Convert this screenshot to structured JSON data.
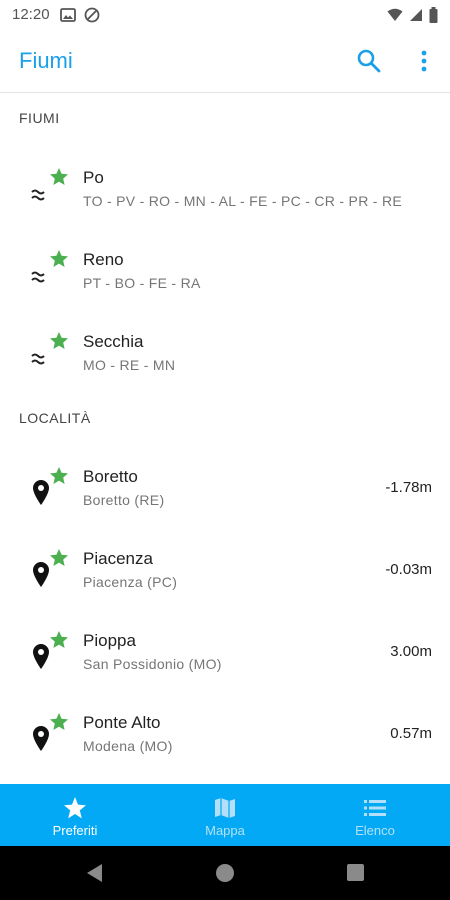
{
  "status_bar": {
    "time": "12:20"
  },
  "app_bar": {
    "title": "Fiumi",
    "search_icon": "search-icon",
    "menu_icon": "more-vert-icon"
  },
  "colors": {
    "accent": "#1aa0e8",
    "bottom_nav": "#03a9f4",
    "star": "#4caf50",
    "inactive_nav": "#b3e0f8"
  },
  "sections": {
    "rivers_header": "FIUMI",
    "locations_header": "LOCALITÀ"
  },
  "rivers": [
    {
      "name": "Po",
      "provinces": "TO - PV - RO - MN - AL - FE - PC - CR - PR - RE"
    },
    {
      "name": "Reno",
      "provinces": "PT - BO - FE - RA"
    },
    {
      "name": "Secchia",
      "provinces": "MO - RE - MN"
    }
  ],
  "locations": [
    {
      "name": "Boretto",
      "place": "Boretto (RE)",
      "level": "-1.78m"
    },
    {
      "name": "Piacenza",
      "place": "Piacenza (PC)",
      "level": "-0.03m"
    },
    {
      "name": "Pioppa",
      "place": "San Possidonio (MO)",
      "level": "3.00m"
    },
    {
      "name": "Ponte Alto",
      "place": "Modena (MO)",
      "level": "0.57m"
    }
  ],
  "bottom_nav": {
    "items": [
      {
        "label": "Preferiti",
        "icon": "star-icon",
        "active": true
      },
      {
        "label": "Mappa",
        "icon": "map-icon",
        "active": false
      },
      {
        "label": "Elenco",
        "icon": "list-icon",
        "active": false
      }
    ]
  }
}
